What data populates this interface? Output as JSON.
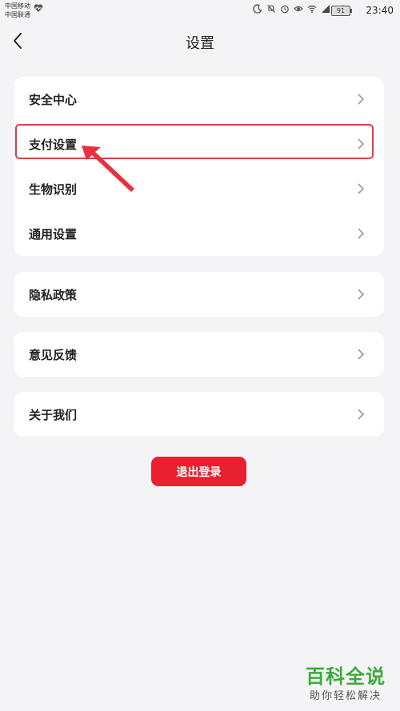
{
  "status_bar": {
    "carrier_1": "中国移动",
    "carrier_2": "中国联通",
    "battery": "91",
    "time": "23:40"
  },
  "header": {
    "title": "设置"
  },
  "groups": [
    {
      "items": [
        "安全中心",
        "支付设置",
        "生物识别",
        "通用设置"
      ]
    },
    {
      "items": [
        "隐私政策"
      ]
    },
    {
      "items": [
        "意见反馈"
      ]
    },
    {
      "items": [
        "关于我们"
      ]
    }
  ],
  "logout_label": "退出登录",
  "highlight_color": "#e23b46",
  "accent_color": "#e8202f",
  "watermark": {
    "main": "百科全说",
    "sub": "助你轻松解决"
  }
}
